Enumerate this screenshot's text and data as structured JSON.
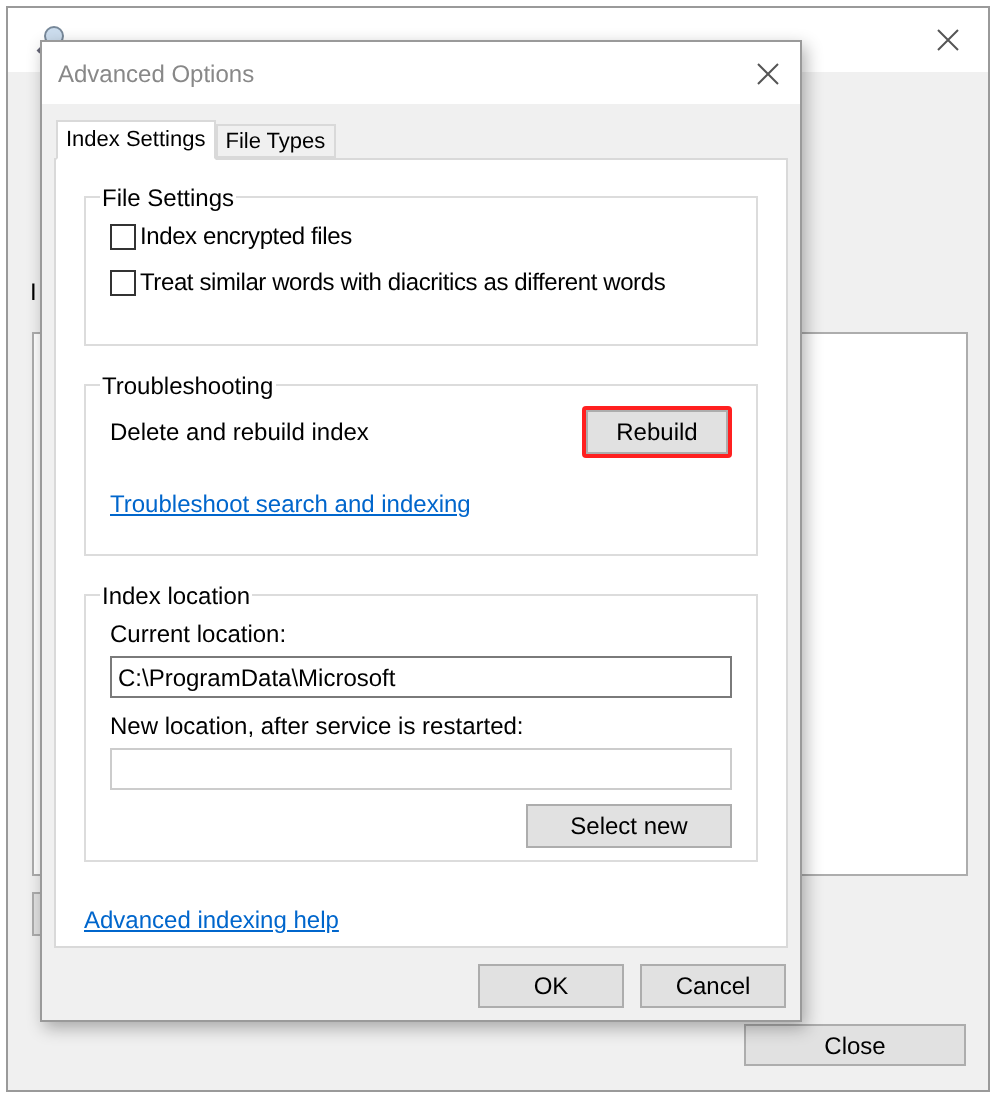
{
  "background_window": {
    "label_fragment": "I",
    "close_button": "Close"
  },
  "dialog": {
    "title": "Advanced Options",
    "tabs": [
      {
        "label": "Index Settings",
        "selected": true
      },
      {
        "label": "File Types",
        "selected": false
      }
    ],
    "file_settings": {
      "title": "File Settings",
      "options": [
        {
          "label": "Index encrypted files",
          "checked": false
        },
        {
          "label": "Treat similar words with diacritics as different words",
          "checked": false
        }
      ]
    },
    "troubleshooting": {
      "title": "Troubleshooting",
      "description": "Delete and rebuild index",
      "button": "Rebuild",
      "button_highlighted": true,
      "link": "Troubleshoot search and indexing"
    },
    "index_location": {
      "title": "Index location",
      "current_label": "Current location:",
      "current_value": "C:\\ProgramData\\Microsoft",
      "new_label": "New location, after service is restarted:",
      "button": "Select new"
    },
    "help_link": "Advanced indexing help",
    "buttons": [
      "OK",
      "Cancel"
    ]
  }
}
